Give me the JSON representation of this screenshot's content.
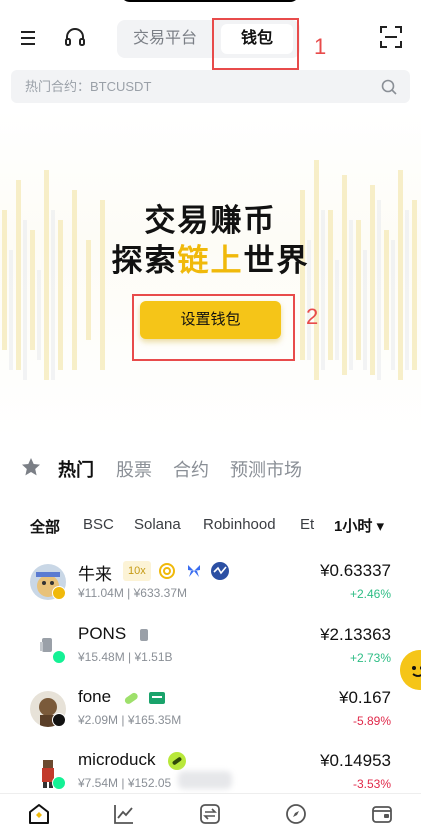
{
  "header": {
    "tabs": [
      {
        "label": "交易平台",
        "active": false
      },
      {
        "label": "钱包",
        "active": true
      }
    ],
    "annotations": [
      "1",
      "2"
    ]
  },
  "search": {
    "placeholder": "热门合约：BTCUSDT"
  },
  "hero": {
    "line1": "交易赚币",
    "line2_pre": "探索",
    "line2_highlight": "链上",
    "line2_post": "世界",
    "button_label": "设置钱包"
  },
  "categories": [
    "热门",
    "股票",
    "合约",
    "预测市场"
  ],
  "filters": {
    "items": [
      "全部",
      "BSC",
      "Solana",
      "Robinhood",
      "Et"
    ],
    "time": "1小时 ▾"
  },
  "tokens": [
    {
      "name": "牛来",
      "tag": "10x",
      "volume": "¥11.04M",
      "mcap": "¥633.37M",
      "price": "¥0.63337",
      "change": "+2.46%",
      "dir": "up"
    },
    {
      "name": "PONS",
      "volume": "¥15.48M",
      "mcap": "¥1.51B",
      "price": "¥2.13363",
      "change": "+2.73%",
      "dir": "up"
    },
    {
      "name": "fone",
      "volume": "¥2.09M",
      "mcap": "¥165.35M",
      "price": "¥0.167",
      "change": "-5.89%",
      "dir": "down"
    },
    {
      "name": "microduck",
      "volume": "¥7.54M",
      "mcap": "¥152.05",
      "price": "¥0.14953",
      "change": "-3.53%",
      "dir": "down"
    }
  ],
  "colors": {
    "brand_yellow": "#f5c518",
    "highlight": "#f0b90b",
    "up_green": "#2ebd85",
    "down_red": "#e0294a",
    "annotation_red": "#e84b4b"
  },
  "nav": [
    "home-icon",
    "chart-icon",
    "swap-icon",
    "discover-icon",
    "wallet-icon"
  ]
}
